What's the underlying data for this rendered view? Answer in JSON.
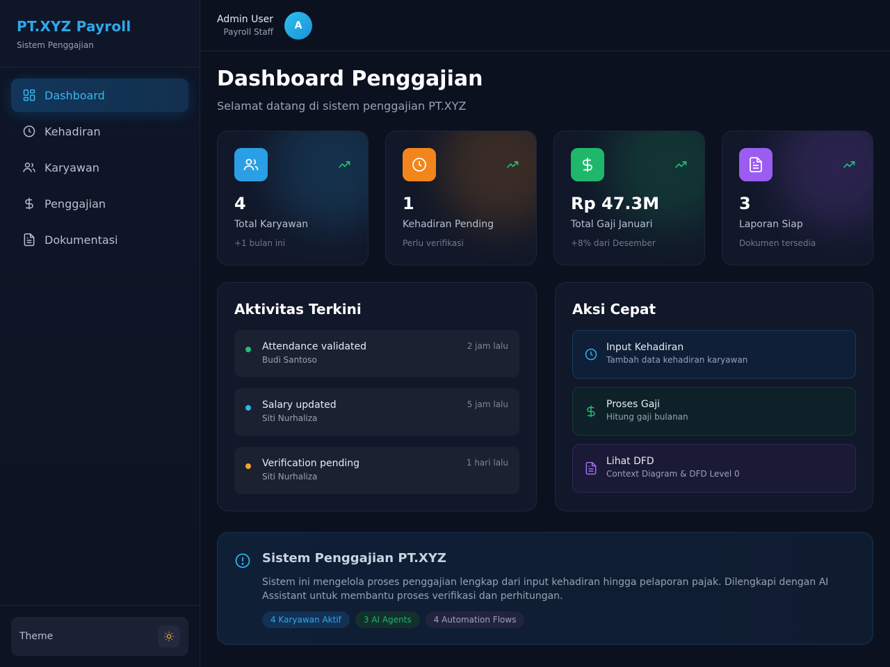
{
  "brand": {
    "title": "PT.XYZ Payroll",
    "subtitle": "Sistem Penggajian"
  },
  "sidebar": {
    "items": [
      {
        "label": "Dashboard",
        "icon": "dashboard-icon",
        "active": true
      },
      {
        "label": "Kehadiran",
        "icon": "clock-icon"
      },
      {
        "label": "Karyawan",
        "icon": "users-icon"
      },
      {
        "label": "Penggajian",
        "icon": "dollar-icon"
      },
      {
        "label": "Dokumentasi",
        "icon": "document-icon"
      }
    ],
    "theme_label": "Theme"
  },
  "user": {
    "name": "Admin User",
    "role": "Payroll Staff",
    "initial": "A"
  },
  "page": {
    "title": "Dashboard Penggajian",
    "subtitle": "Selamat datang di sistem penggajian PT.XYZ"
  },
  "stats": [
    {
      "value": "4",
      "label": "Total Karyawan",
      "note": "+1 bulan ini",
      "icon": "users-icon",
      "color": "#2b9fe6"
    },
    {
      "value": "1",
      "label": "Kehadiran Pending",
      "note": "Perlu verifikasi",
      "icon": "clock-icon",
      "color": "#f2861c"
    },
    {
      "value": "Rp 47.3M",
      "label": "Total Gaji Januari",
      "note": "+8% dari Desember",
      "icon": "dollar-icon",
      "color": "#1fb86b"
    },
    {
      "value": "3",
      "label": "Laporan Siap",
      "note": "Dokumen tersedia",
      "icon": "document-icon",
      "color": "#9b5cf2"
    }
  ],
  "activity": {
    "title": "Aktivitas Terkini",
    "items": [
      {
        "title": "Attendance validated",
        "sub": "Budi Santoso",
        "time": "2 jam lalu",
        "color": "#22c076"
      },
      {
        "title": "Salary updated",
        "sub": "Siti Nurhaliza",
        "time": "5 jam lalu",
        "color": "#2fb3ee"
      },
      {
        "title": "Verification pending",
        "sub": "Siti Nurhaliza",
        "time": "1 hari lalu",
        "color": "#f3a42d"
      }
    ]
  },
  "quick": {
    "title": "Aksi Cepat",
    "items": [
      {
        "title": "Input Kehadiran",
        "sub": "Tambah data kehadiran karyawan",
        "icon": "clock-icon"
      },
      {
        "title": "Proses Gaji",
        "sub": "Hitung gaji bulanan",
        "icon": "dollar-icon"
      },
      {
        "title": "Lihat DFD",
        "sub": "Context Diagram & DFD Level 0",
        "icon": "document-icon"
      }
    ]
  },
  "info": {
    "title": "Sistem Penggajian PT.XYZ",
    "text": "Sistem ini mengelola proses penggajian lengkap dari input kehadiran hingga pelaporan pajak. Dilengkapi dengan AI Assistant untuk membantu proses verifikasi dan perhitungan.",
    "tags": [
      "4 Karyawan Aktif",
      "3 AI Agents",
      "4 Automation Flows"
    ]
  }
}
